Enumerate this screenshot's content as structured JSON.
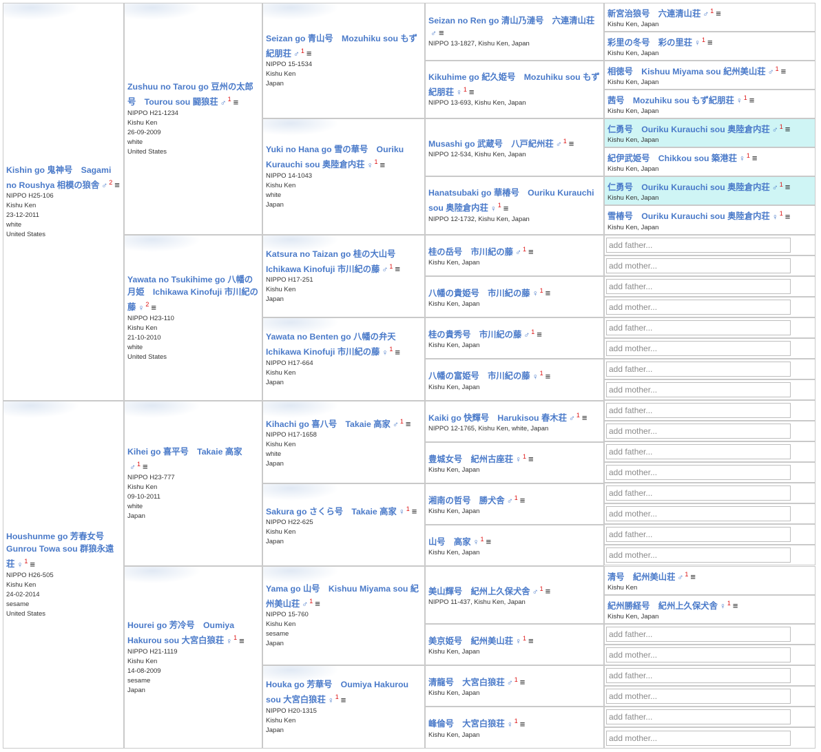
{
  "generations": [
    [
      {
        "name": "Kishin go 鬼神号　Sagami no Roushya 相模の狼舎",
        "sex": "♂",
        "count": "2",
        "info": [
          "NIPPO H25-106",
          "Kishu Ken",
          "23-12-2011",
          "white",
          "United States"
        ]
      },
      {
        "name": "Houshunme go 芳春女号　Gunrou Towa sou 群狼永遠荘",
        "sex": "♀",
        "count": "1",
        "info": [
          "NIPPO H26-505",
          "Kishu Ken",
          "24-02-2014",
          "sesame",
          "United States"
        ]
      }
    ],
    [
      {
        "name": "Zushuu no Tarou go 豆州の太郎号　Tourou sou 闘狼荘",
        "sex": "♂",
        "count": "1",
        "info": [
          "NIPPO H21-1234",
          "Kishu Ken",
          "26-09-2009",
          "white",
          "United States"
        ]
      },
      {
        "name": "Yawata no Tsukihime go 八幡の月姫　Ichikawa Kinofuji 市川紀の藤",
        "sex": "♀",
        "count": "2",
        "info": [
          "NIPPO H23-110",
          "Kishu Ken",
          "21-10-2010",
          "white",
          "United States"
        ]
      },
      {
        "name": "Kihei go 喜平号　Takaie 高家",
        "sex": "♂",
        "count": "1",
        "info": [
          "NIPPO H23-777",
          "Kishu Ken",
          "09-10-2011",
          "white",
          "Japan"
        ]
      },
      {
        "name": "Hourei go 芳冷号　Oumiya Hakurou sou 大宮白狼荘",
        "sex": "♀",
        "count": "1",
        "info": [
          "NIPPO H21-1119",
          "Kishu Ken",
          "14-08-2009",
          "sesame",
          "Japan"
        ]
      }
    ],
    [
      {
        "name": "Seizan go 青山号　Mozuhiku sou もず紀朋荘",
        "sex": "♂",
        "count": "1",
        "info": [
          "NIPPO 15-1534",
          "Kishu Ken",
          "Japan"
        ]
      },
      {
        "name": "Yuki no Hana go 雪の華号　Ouriku Kurauchi sou 奥陸倉内荘",
        "sex": "♀",
        "count": "1",
        "info": [
          "NIPPO 14-1043",
          "Kishu Ken",
          "white",
          "Japan"
        ]
      },
      {
        "name": "Katsura no Taizan go 桂の大山号　Ichikawa Kinofuji 市川紀の藤",
        "sex": "♂",
        "count": "1",
        "info": [
          "NIPPO H17-251",
          "Kishu Ken",
          "Japan"
        ]
      },
      {
        "name": "Yawata no Benten go 八幡の弁天　Ichikawa Kinofuji 市川紀の藤",
        "sex": "♀",
        "count": "1",
        "info": [
          "NIPPO H17-664",
          "Kishu Ken",
          "Japan"
        ]
      },
      {
        "name": "Kihachi go 喜八号　Takaie 高家",
        "sex": "♂",
        "count": "1",
        "info": [
          "NIPPO H17-1658",
          "Kishu Ken",
          "white",
          "Japan"
        ]
      },
      {
        "name": "Sakura go さくら号　Takaie 高家",
        "sex": "♀",
        "count": "1",
        "info": [
          "NIPPO H22-625",
          "Kishu Ken",
          "Japan"
        ]
      },
      {
        "name": "Yama go 山号　Kishuu Miyama sou 紀州美山荘",
        "sex": "♂",
        "count": "1",
        "info": [
          "NIPPO 15-760",
          "Kishu Ken",
          "sesame",
          "Japan"
        ]
      },
      {
        "name": "Houka go 芳華号　Oumiya Hakurou sou 大宮白狼荘",
        "sex": "♀",
        "count": "1",
        "info": [
          "NIPPO H20-1315",
          "Kishu Ken",
          "Japan"
        ]
      }
    ],
    [
      {
        "name": "Seizan no Ren go 清山乃漣号　六連清山荘",
        "sex": "♂",
        "count": "",
        "info": [
          "NIPPO 13-1827, Kishu Ken, Japan"
        ]
      },
      {
        "name": "Kikuhime go 紀久姫号　Mozuhiku sou もず紀朋荘",
        "sex": "♀",
        "count": "1",
        "info": [
          "NIPPO 13-693, Kishu Ken, Japan"
        ]
      },
      {
        "name": "Musashi go 武蔵号　八戸紀州荘",
        "sex": "♂",
        "count": "1",
        "info": [
          "NIPPO 12-534, Kishu Ken, Japan"
        ]
      },
      {
        "name": "Hanatsubaki go 華椿号　Ouriku Kurauchi sou 奥陸倉内荘",
        "sex": "♀",
        "count": "1",
        "info": [
          "NIPPO 12-1732, Kishu Ken, Japan"
        ]
      },
      {
        "name": "桂の岳号　市川紀の藤",
        "sex": "♂",
        "count": "1",
        "info": [
          "Kishu Ken, Japan"
        ]
      },
      {
        "name": "八幡の貴姫号　市川紀の藤",
        "sex": "♀",
        "count": "1",
        "info": [
          "Kishu Ken, Japan"
        ]
      },
      {
        "name": "桂の貴秀号　市川紀の藤",
        "sex": "♂",
        "count": "1",
        "info": [
          "Kishu Ken, Japan"
        ]
      },
      {
        "name": "八幡の富姫号　市川紀の藤",
        "sex": "♀",
        "count": "1",
        "info": [
          "Kishu Ken, Japan"
        ]
      },
      {
        "name": "Kaiki go 快輝号　Harukisou 春木荘",
        "sex": "♂",
        "count": "1",
        "info": [
          "NIPPO 12-1765, Kishu Ken, white, Japan"
        ]
      },
      {
        "name": "豊城女号　紀州古座荘",
        "sex": "♀",
        "count": "1",
        "info": [
          "Kishu Ken, Japan"
        ]
      },
      {
        "name": "湘南の哲号　勝犬舎",
        "sex": "♂",
        "count": "1",
        "info": [
          "Kishu Ken, Japan"
        ]
      },
      {
        "name": "山号　高家",
        "sex": "♀",
        "count": "1",
        "info": [
          "Kishu Ken, Japan"
        ]
      },
      {
        "name": "美山輝号　紀州上久保犬舎",
        "sex": "♂",
        "count": "1",
        "info": [
          "NIPPO 11-437, Kishu Ken, Japan"
        ]
      },
      {
        "name": "美京姫号　紀州美山荘",
        "sex": "♀",
        "count": "1",
        "info": [
          "Kishu Ken, Japan"
        ]
      },
      {
        "name": "清龍号　大宮白狼荘",
        "sex": "♂",
        "count": "1",
        "info": [
          "Kishu Ken, Japan"
        ]
      },
      {
        "name": "峰倫号　大宮白狼荘",
        "sex": "♀",
        "count": "1",
        "info": [
          "Kishu Ken, Japan"
        ]
      }
    ],
    [
      {
        "name": "新宮治狼号　六連清山荘",
        "sex": "♂",
        "count": "1",
        "info": [
          "Kishu Ken, Japan"
        ]
      },
      {
        "name": "彩里の冬号　彩の里荘",
        "sex": "♀",
        "count": "1",
        "info": [
          "Kishu Ken, Japan"
        ]
      },
      {
        "name": "相徳号　Kishuu Miyama sou 紀州美山荘",
        "sex": "♂",
        "count": "1",
        "info": [
          "Kishu Ken, Japan"
        ]
      },
      {
        "name": "茜号　Mozuhiku sou もず紀朋荘",
        "sex": "♀",
        "count": "1",
        "info": [
          "Kishu Ken, Japan"
        ]
      },
      {
        "name": "仁勇号　Ouriku Kurauchi sou 奥陸倉内荘",
        "sex": "♂",
        "count": "1",
        "info": [
          "Kishu Ken, Japan"
        ],
        "highlight": true
      },
      {
        "name": "紀伊武姫号　Chikkou sou 築港荘",
        "sex": "♀",
        "count": "1",
        "info": [
          "Kishu Ken, Japan"
        ]
      },
      {
        "name": "仁勇号　Ouriku Kurauchi sou 奥陸倉内荘",
        "sex": "♂",
        "count": "1",
        "info": [
          "Kishu Ken, Japan"
        ],
        "highlight": true
      },
      {
        "name": "雪椿号　Ouriku Kurauchi sou 奥陸倉内荘",
        "sex": "♀",
        "count": "1",
        "info": [
          "Kishu Ken, Japan"
        ]
      },
      {
        "add": "father"
      },
      {
        "add": "mother"
      },
      {
        "add": "father"
      },
      {
        "add": "mother"
      },
      {
        "add": "father"
      },
      {
        "add": "mother"
      },
      {
        "add": "father"
      },
      {
        "add": "mother"
      },
      {
        "add": "father"
      },
      {
        "add": "mother"
      },
      {
        "add": "father"
      },
      {
        "add": "mother"
      },
      {
        "add": "father"
      },
      {
        "add": "mother"
      },
      {
        "add": "father"
      },
      {
        "add": "mother"
      },
      {
        "name": "清号　紀州美山荘",
        "sex": "♂",
        "count": "1",
        "info": [
          "Kishu Ken"
        ]
      },
      {
        "name": "紀州勝経号　紀州上久保犬舎",
        "sex": "♀",
        "count": "1",
        "info": [
          "Kishu Ken, Japan"
        ]
      },
      {
        "add": "father"
      },
      {
        "add": "mother"
      },
      {
        "add": "father"
      },
      {
        "add": "mother"
      },
      {
        "add": "father"
      },
      {
        "add": "mother"
      }
    ]
  ],
  "placeholders": {
    "father": "add father...",
    "mother": "add mother..."
  },
  "menu_glyph": "≡",
  "colors": {
    "link": "#4a7ac9",
    "count": "#dd1111",
    "highlight": "#cff5f5",
    "border": "#c9c9c9"
  }
}
